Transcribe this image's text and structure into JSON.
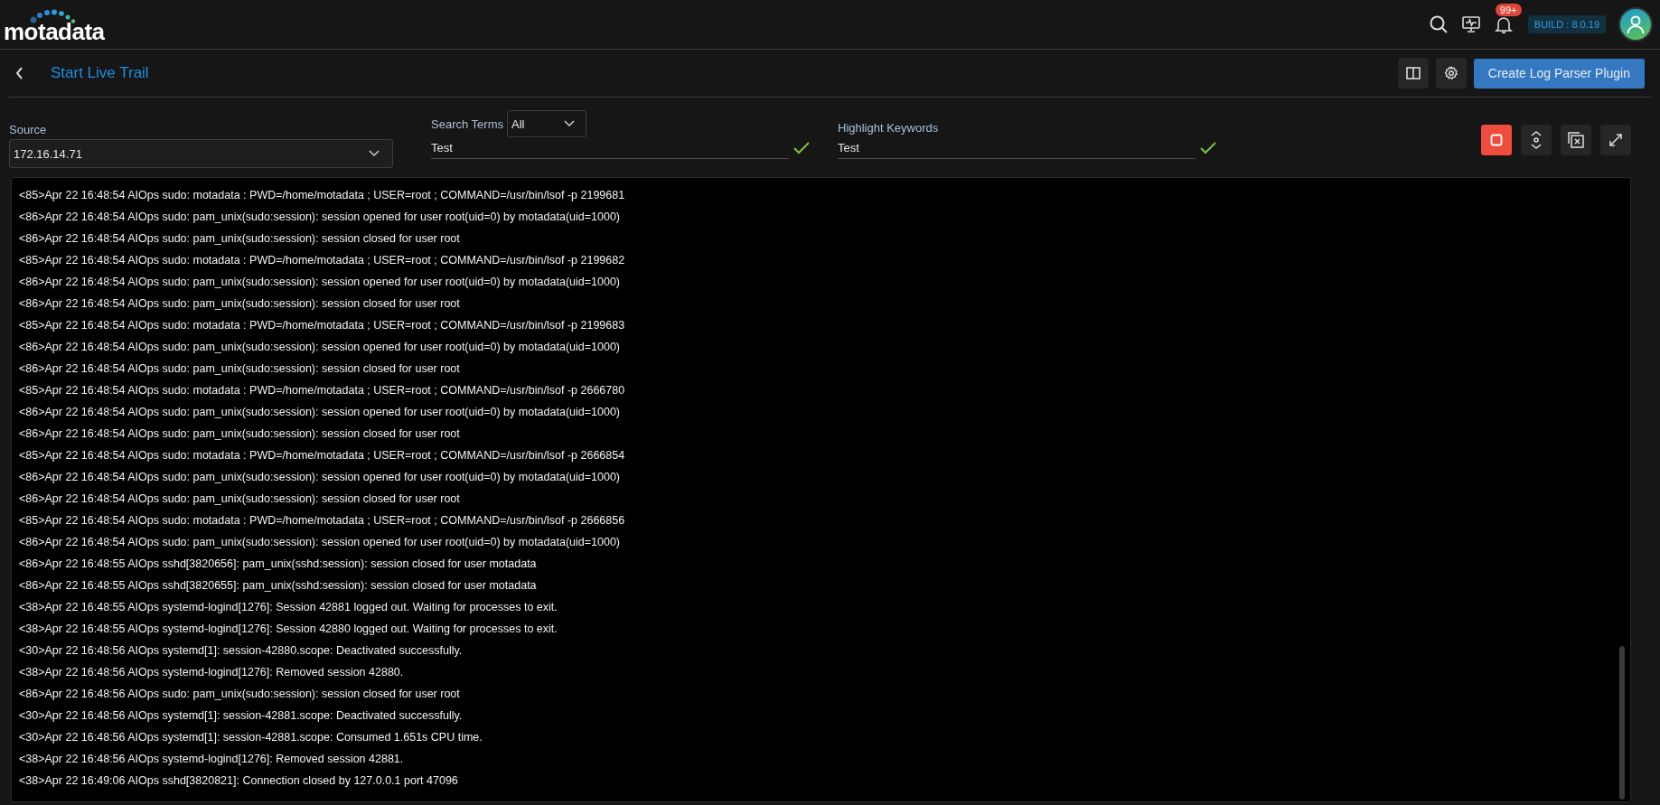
{
  "header": {
    "logo": "motadata",
    "notification_count": "99+",
    "build": "BUILD : 8.0.19"
  },
  "page": {
    "title": "Start Live Trail",
    "primary_button": "Create Log Parser Plugin"
  },
  "filters": {
    "source": {
      "label": "Source",
      "value": "172.16.14.71"
    },
    "search_terms": {
      "label": "Search Terms",
      "mode": "All",
      "value": "Test",
      "valid": true
    },
    "highlight_keywords": {
      "label": "Highlight Keywords",
      "value": "Test",
      "valid": true
    }
  },
  "log_lines": [
    "<85>Apr 22 16:48:54 AIOps sudo: motadata : PWD=/home/motadata ; USER=root ; COMMAND=/usr/bin/lsof -p 2199681",
    "<86>Apr 22 16:48:54 AIOps sudo: pam_unix(sudo:session): session opened for user root(uid=0) by motadata(uid=1000)",
    "<86>Apr 22 16:48:54 AIOps sudo: pam_unix(sudo:session): session closed for user root",
    "<85>Apr 22 16:48:54 AIOps sudo: motadata : PWD=/home/motadata ; USER=root ; COMMAND=/usr/bin/lsof -p 2199682",
    "<86>Apr 22 16:48:54 AIOps sudo: pam_unix(sudo:session): session opened for user root(uid=0) by motadata(uid=1000)",
    "<86>Apr 22 16:48:54 AIOps sudo: pam_unix(sudo:session): session closed for user root",
    "<85>Apr 22 16:48:54 AIOps sudo: motadata : PWD=/home/motadata ; USER=root ; COMMAND=/usr/bin/lsof -p 2199683",
    "<86>Apr 22 16:48:54 AIOps sudo: pam_unix(sudo:session): session opened for user root(uid=0) by motadata(uid=1000)",
    "<86>Apr 22 16:48:54 AIOps sudo: pam_unix(sudo:session): session closed for user root",
    "<85>Apr 22 16:48:54 AIOps sudo: motadata : PWD=/home/motadata ; USER=root ; COMMAND=/usr/bin/lsof -p 2666780",
    "<86>Apr 22 16:48:54 AIOps sudo: pam_unix(sudo:session): session opened for user root(uid=0) by motadata(uid=1000)",
    "<86>Apr 22 16:48:54 AIOps sudo: pam_unix(sudo:session): session closed for user root",
    "<85>Apr 22 16:48:54 AIOps sudo: motadata : PWD=/home/motadata ; USER=root ; COMMAND=/usr/bin/lsof -p 2666854",
    "<86>Apr 22 16:48:54 AIOps sudo: pam_unix(sudo:session): session opened for user root(uid=0) by motadata(uid=1000)",
    "<86>Apr 22 16:48:54 AIOps sudo: pam_unix(sudo:session): session closed for user root",
    "<85>Apr 22 16:48:54 AIOps sudo: motadata : PWD=/home/motadata ; USER=root ; COMMAND=/usr/bin/lsof -p 2666856",
    "<86>Apr 22 16:48:54 AIOps sudo: pam_unix(sudo:session): session opened for user root(uid=0) by motadata(uid=1000)",
    "<86>Apr 22 16:48:55 AIOps sshd[3820656]: pam_unix(sshd:session): session closed for user motadata",
    "<86>Apr 22 16:48:55 AIOps sshd[3820655]: pam_unix(sshd:session): session closed for user motadata",
    "<38>Apr 22 16:48:55 AIOps systemd-logind[1276]: Session 42881 logged out. Waiting for processes to exit.",
    "<38>Apr 22 16:48:55 AIOps systemd-logind[1276]: Session 42880 logged out. Waiting for processes to exit.",
    "<30>Apr 22 16:48:56 AIOps systemd[1]: session-42880.scope: Deactivated successfully.",
    "<38>Apr 22 16:48:56 AIOps systemd-logind[1276]: Removed session 42880.",
    "<86>Apr 22 16:48:56 AIOps sudo: pam_unix(sudo:session): session closed for user root",
    "<30>Apr 22 16:48:56 AIOps systemd[1]: session-42881.scope: Deactivated successfully.",
    "<30>Apr 22 16:48:56 AIOps systemd[1]: session-42881.scope: Consumed 1.651s CPU time.",
    "<38>Apr 22 16:48:56 AIOps systemd-logind[1276]: Removed session 42881.",
    "<38>Apr 22 16:49:06 AIOps sshd[3820821]: Connection closed by 127.0.0.1 port 47096"
  ]
}
